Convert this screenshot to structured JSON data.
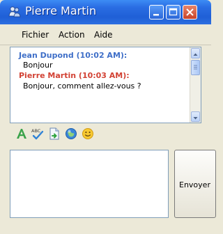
{
  "window": {
    "title": "Pierre Martin",
    "icon": "messenger-user-icon",
    "controls": [
      "minimize",
      "maximize",
      "close"
    ]
  },
  "menu": {
    "items": [
      {
        "label": "Fichier"
      },
      {
        "label": "Action"
      },
      {
        "label": "Aide"
      }
    ]
  },
  "chat": {
    "messages": [
      {
        "sender": "Jean Dupond (10:02 AM):",
        "text": "Bonjour",
        "color": "#3f6fc8"
      },
      {
        "sender": "Pierre Martin (10:03 AM):",
        "text": "Bonjour, comment allez-vous ?",
        "color": "#d24234"
      }
    ]
  },
  "toolbar": {
    "icons": [
      "font-icon",
      "spellcheck-icon",
      "send-file-icon",
      "background-icon",
      "emoticon-icon"
    ]
  },
  "input": {
    "value": ""
  },
  "send": {
    "label": "Envoyer"
  }
}
